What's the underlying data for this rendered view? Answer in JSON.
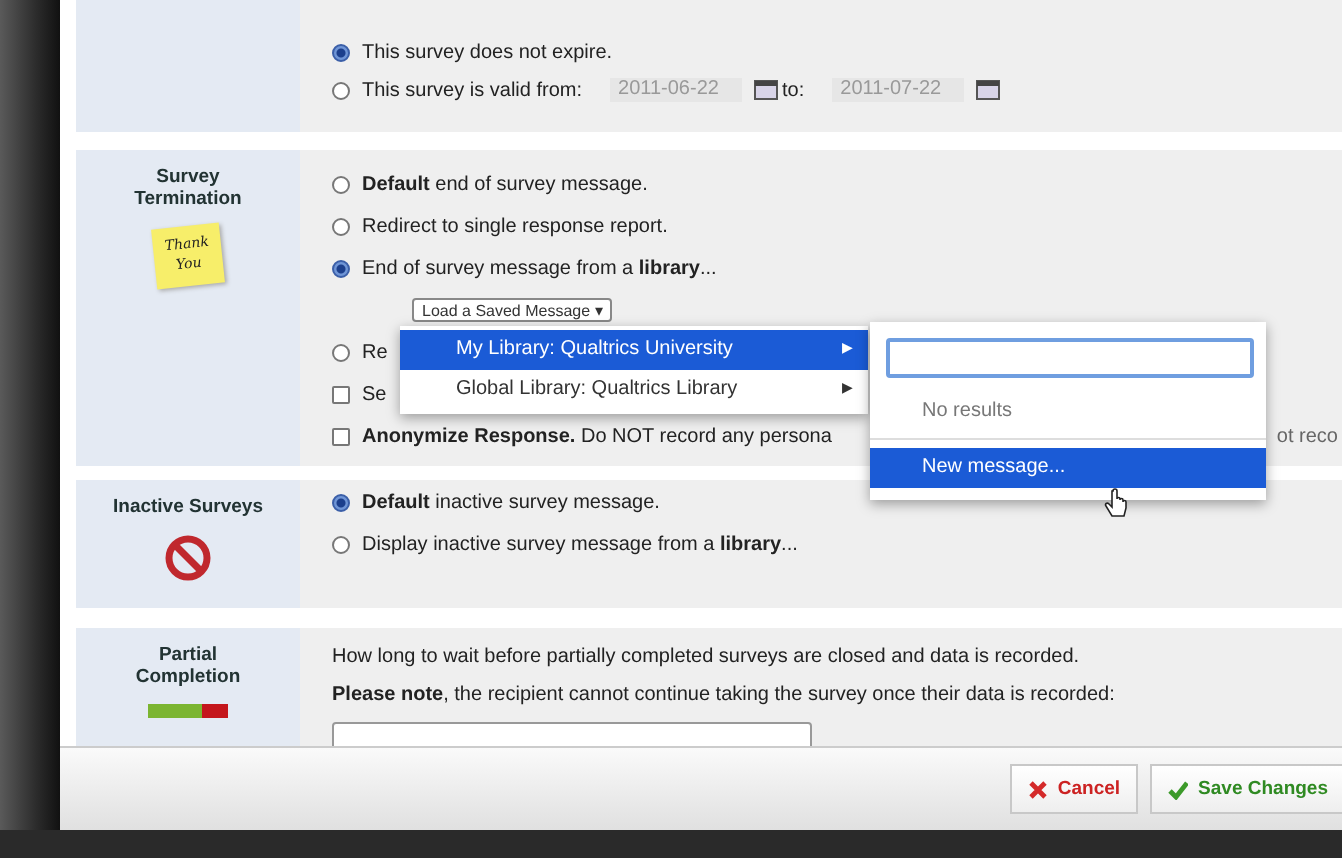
{
  "expiration": {
    "options": [
      {
        "label": "This survey does not expire.",
        "selected": true
      },
      {
        "label": "This survey is valid from:",
        "selected": false
      }
    ],
    "from_date": "2011-06-22",
    "to_label": "to:",
    "to_date": "2011-07-22"
  },
  "termination": {
    "heading": "Survey Termination",
    "note": "Thank You",
    "rows": [
      {
        "kind": "radio",
        "label": "**Default** end of survey message.",
        "selected": false
      },
      {
        "kind": "radio",
        "label": "Redirect to single response report.",
        "selected": false
      },
      {
        "kind": "radio",
        "label": "End of survey message from a **library**...",
        "selected": true
      },
      {
        "kind": "button",
        "label": "Load a Saved Message ▾"
      },
      {
        "kind": "radio",
        "label": "Re",
        "selected": false
      },
      {
        "kind": "checkbox",
        "label": "Se",
        "checked": false
      },
      {
        "kind": "checkbox",
        "label": "**Anonymize Response.** Do NOT record any persona",
        "tail": "ot reco",
        "checked": false
      }
    ]
  },
  "library_menu": {
    "items": [
      {
        "label": "My Library: Qualtrics University",
        "arrow": "▶",
        "selected": true
      },
      {
        "label": "Global Library: Qualtrics Library",
        "arrow": "▶",
        "selected": false
      }
    ]
  },
  "message_menu": {
    "empty_text": "No results",
    "items": [
      {
        "label": "New message...",
        "selected": true
      }
    ]
  },
  "inactive": {
    "heading": "Inactive Surveys",
    "options": [
      {
        "label": "**Default** inactive survey message.",
        "selected": true
      },
      {
        "label": "Display inactive survey message from a **library**...",
        "selected": false
      }
    ]
  },
  "partial": {
    "heading": "Partial Completion",
    "lines": [
      "How long to wait before partially completed surveys are closed and data is recorded.",
      "**Please note**, the recipient cannot continue taking the survey once their data is recorded:"
    ]
  },
  "buttons": [
    {
      "kind": "cancel",
      "label": "Cancel"
    },
    {
      "kind": "save",
      "label": "Save Changes"
    }
  ]
}
